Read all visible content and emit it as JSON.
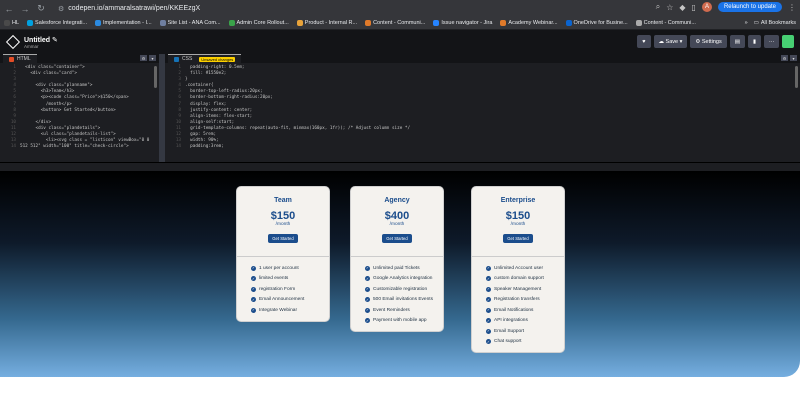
{
  "browser": {
    "url": "codepen.io/ammaralsatrawi/pen/KKEEzgX",
    "relaunch_label": "Relaunch to update",
    "profile_initial": "A",
    "bookmarks": [
      {
        "label": "HL",
        "color": "#4a4a4a"
      },
      {
        "label": "Salesforce Integrati...",
        "color": "#00a1e0"
      },
      {
        "label": "Implementation - I...",
        "color": "#2b8ae0"
      },
      {
        "label": "Site List - ANA Com...",
        "color": "#6f7fa0"
      },
      {
        "label": "Admin Core Rollout...",
        "color": "#3aa34a"
      },
      {
        "label": "Product - Internal R...",
        "color": "#e8a33a"
      },
      {
        "label": "Content - Communi...",
        "color": "#e07a2a"
      },
      {
        "label": "Issue navigator - Jira",
        "color": "#2684ff"
      },
      {
        "label": "Academy Webinar...",
        "color": "#e07a2a"
      },
      {
        "label": "OneDrive for Busine...",
        "color": "#0a64d0"
      },
      {
        "label": "Content - Communi...",
        "color": "#aaaaaa"
      }
    ],
    "more_bookmarks": "»",
    "all_bookmarks": "All Bookmarks"
  },
  "codepen": {
    "title": "Untitled",
    "user": "Ammar",
    "buttons": {
      "save": "Save",
      "settings": "Settings"
    }
  },
  "editors": {
    "html_tab": "HTML",
    "css_tab": "CSS",
    "css_hint": "Unsaved changes",
    "html_lines": [
      "  <div class=\"container\">",
      "    <div class=\"card\">",
      "",
      "      <div class=\"planname\">",
      "        <h3>Team</h3>",
      "        <p><code class=\"Price\">$150</span>",
      "          /month</p>",
      "        <button> Get Started</button>",
      "",
      "      </div>",
      "      <div class=\"plandetails\">",
      "        <ul class=\"plandetails-list\">",
      "          <li><svg class = \"listicon\" viewBox=\"0 0",
      "512 512\" width=\"100\" title=\"check-circle\">"
    ],
    "css_lines": [
      "  padding-right: 0.5em;",
      "  fill: #1550e2;",
      "}",
      ".container{",
      "  border-top-left-radius:20px;",
      "  border-bottom-right-radius:20px;",
      "  display: flex;",
      "  justify-content: center;",
      "  align-items: flex-start;",
      "  align-self:start;",
      "  grid-template-columns: repeat(auto-fit, minmax(160px, 1fr)); /* Adjust column size */",
      "  gap: 5rem;",
      "  width: 90%;",
      "  padding:3rem;"
    ]
  },
  "plans": [
    {
      "name": "Team",
      "price": "$150",
      "period": "/month",
      "cta": "Get Started",
      "features": [
        "1 user per account",
        "limited events",
        "registration Form",
        "Email Announcement",
        "Integrate Webinar"
      ]
    },
    {
      "name": "Agency",
      "price": "$400",
      "period": "/month",
      "cta": "Get Started",
      "features": [
        "Unlimited paid Tickets",
        "Google Analytics integration",
        "Customizable registration",
        "500 Email invitations Events",
        "Event Reminders",
        "Payment with mobile app"
      ]
    },
    {
      "name": "Enterprise",
      "price": "$150",
      "period": "/month",
      "cta": "Get Started",
      "features": [
        "Unlimited Account user",
        "custom domain support",
        "Speaker Management",
        "Registration transfers",
        "Email Notifications",
        "API integrations",
        "Email Support",
        "Chat support"
      ]
    }
  ]
}
